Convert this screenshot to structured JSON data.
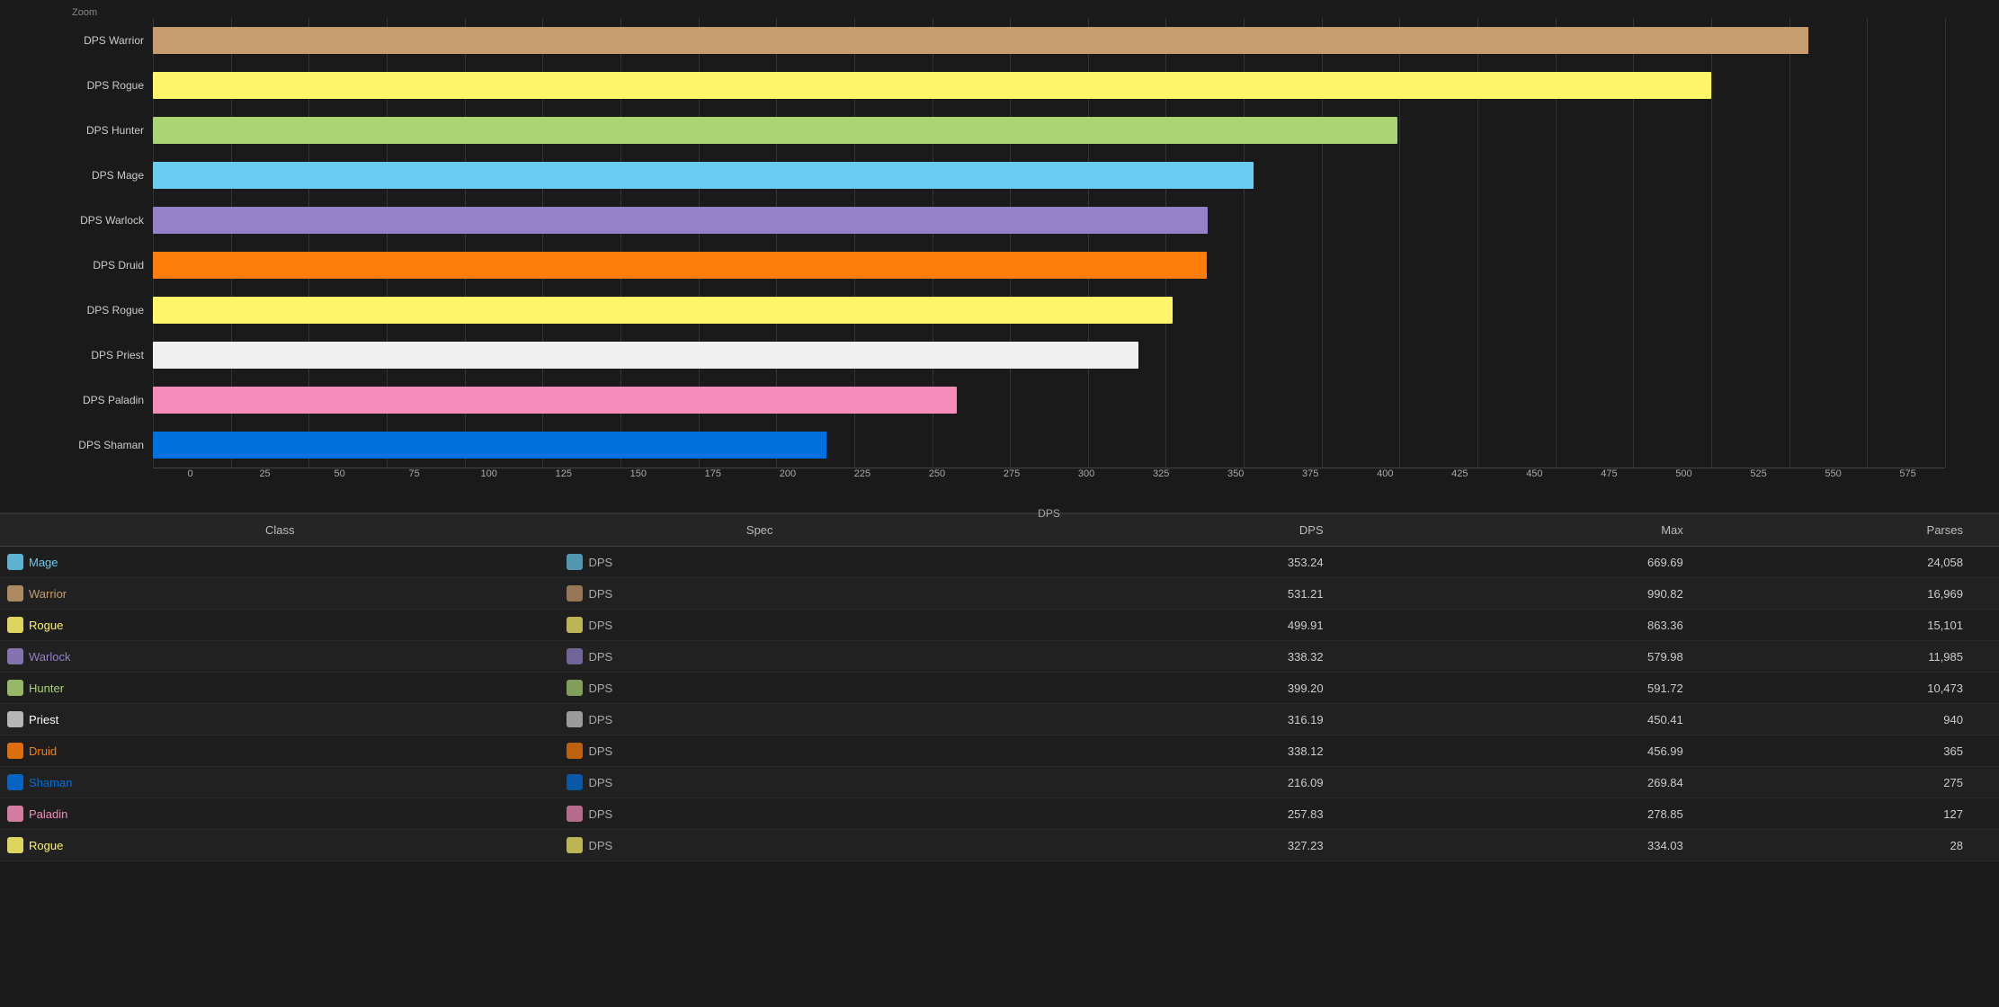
{
  "chart": {
    "zoom_label": "Zoom",
    "x_axis_label": "DPS",
    "x_ticks": [
      "0",
      "25",
      "50",
      "75",
      "100",
      "125",
      "150",
      "175",
      "200",
      "225",
      "250",
      "275",
      "300",
      "325",
      "350",
      "375",
      "400",
      "425",
      "450",
      "475",
      "500",
      "525",
      "550",
      "575"
    ],
    "bars": [
      {
        "label": "DPS Warrior",
        "value": 531.21,
        "max_value": 575,
        "color": "#C79C6E"
      },
      {
        "label": "DPS Rogue",
        "value": 499.91,
        "max_value": 575,
        "color": "#FFF569"
      },
      {
        "label": "DPS Hunter",
        "value": 399.2,
        "max_value": 575,
        "color": "#ABD473"
      },
      {
        "label": "DPS Mage",
        "value": 353.24,
        "max_value": 575,
        "color": "#69CCF0"
      },
      {
        "label": "DPS Warlock",
        "value": 338.32,
        "max_value": 575,
        "color": "#9482C9"
      },
      {
        "label": "DPS Druid",
        "value": 338.12,
        "max_value": 575,
        "color": "#FF7D0A"
      },
      {
        "label": "DPS Rogue",
        "value": 327.23,
        "max_value": 575,
        "color": "#FFF569"
      },
      {
        "label": "DPS Priest",
        "value": 316.19,
        "max_value": 575,
        "color": "#F0F0F0"
      },
      {
        "label": "DPS Paladin",
        "value": 257.83,
        "max_value": 575,
        "color": "#F58CBA"
      },
      {
        "label": "DPS Shaman",
        "value": 216.09,
        "max_value": 575,
        "color": "#0070DE"
      }
    ]
  },
  "table": {
    "headers": [
      "Class",
      "Spec",
      "DPS",
      "Max",
      "Parses"
    ],
    "rows": [
      {
        "class": "Mage",
        "class_color": "class-mage",
        "spec": "DPS",
        "dps": "353.24",
        "max": "669.69",
        "parses": "24,058"
      },
      {
        "class": "Warrior",
        "class_color": "class-warrior",
        "spec": "DPS",
        "dps": "531.21",
        "max": "990.82",
        "parses": "16,969"
      },
      {
        "class": "Rogue",
        "class_color": "class-rogue",
        "spec": "DPS",
        "dps": "499.91",
        "max": "863.36",
        "parses": "15,101"
      },
      {
        "class": "Warlock",
        "class_color": "class-warlock",
        "spec": "DPS",
        "dps": "338.32",
        "max": "579.98",
        "parses": "11,985"
      },
      {
        "class": "Hunter",
        "class_color": "class-hunter",
        "spec": "DPS",
        "dps": "399.20",
        "max": "591.72",
        "parses": "10,473"
      },
      {
        "class": "Priest",
        "class_color": "class-priest",
        "spec": "DPS",
        "dps": "316.19",
        "max": "450.41",
        "parses": "940"
      },
      {
        "class": "Druid",
        "class_color": "class-druid",
        "spec": "DPS",
        "dps": "338.12",
        "max": "456.99",
        "parses": "365"
      },
      {
        "class": "Shaman",
        "class_color": "class-shaman",
        "spec": "DPS",
        "dps": "216.09",
        "max": "269.84",
        "parses": "275"
      },
      {
        "class": "Paladin",
        "class_color": "class-paladin",
        "spec": "DPS",
        "dps": "257.83",
        "max": "278.85",
        "parses": "127"
      },
      {
        "class": "Rogue",
        "class_color": "class-rogue",
        "spec": "DPS",
        "dps": "327.23",
        "max": "334.03",
        "parses": "28"
      }
    ]
  },
  "class_icon_colors": {
    "Mage": "#69CCF0",
    "Warrior": "#C79C6E",
    "Rogue": "#FFF569",
    "Warlock": "#9482C9",
    "Hunter": "#ABD473",
    "Priest": "#D0D0D0",
    "Druid": "#FF7D0A",
    "Shaman": "#0070DE",
    "Paladin": "#F58CBA"
  }
}
